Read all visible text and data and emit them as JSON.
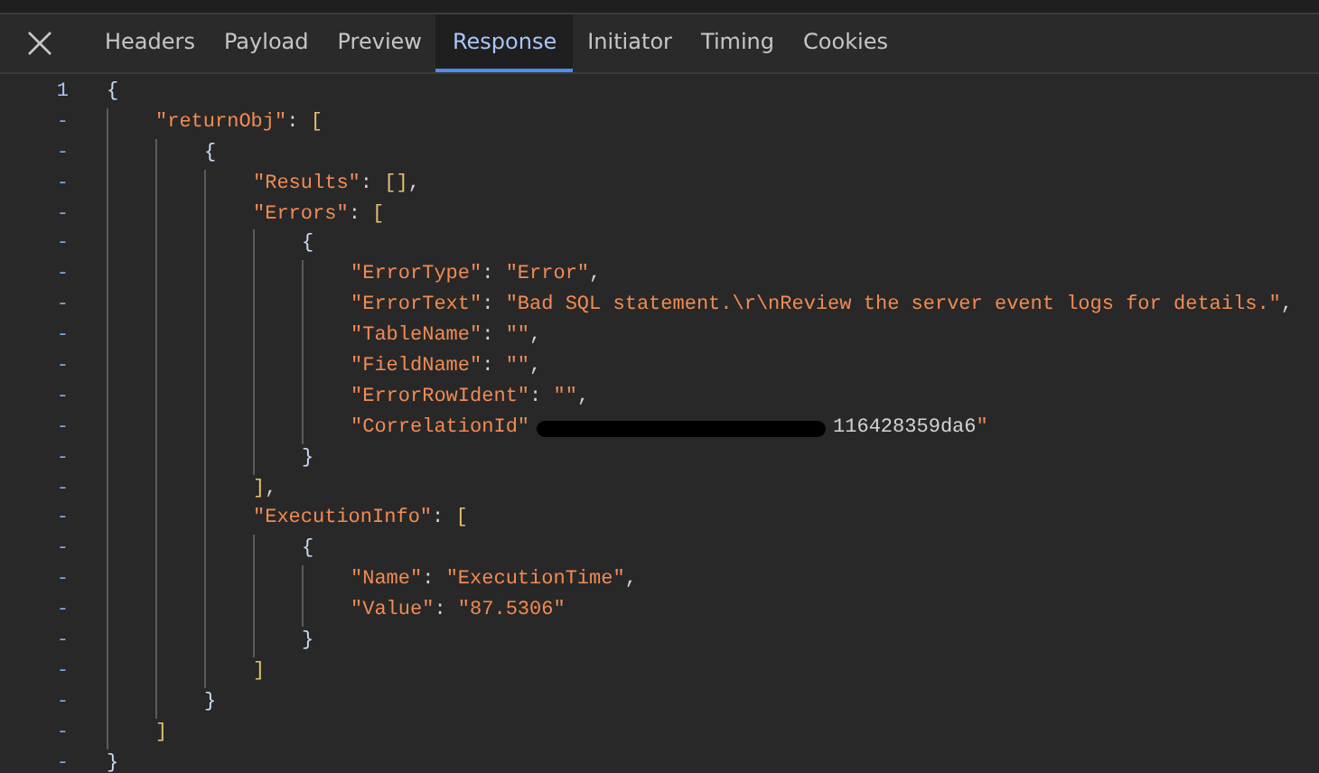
{
  "tabs": [
    {
      "label": "Headers",
      "selected": false
    },
    {
      "label": "Payload",
      "selected": false
    },
    {
      "label": "Preview",
      "selected": false
    },
    {
      "label": "Response",
      "selected": true
    },
    {
      "label": "Initiator",
      "selected": false
    },
    {
      "label": "Timing",
      "selected": false
    },
    {
      "label": "Cookies",
      "selected": false
    }
  ],
  "code": {
    "lines": [
      {
        "gutter": "1",
        "text": "{",
        "children": [
          {
            "gutter": "-",
            "text": "\"returnObj\": [",
            "children": [
              {
                "gutter": "-",
                "text": "{",
                "children": [
                  {
                    "gutter": "-",
                    "text": "\"Results\": [],"
                  },
                  {
                    "gutter": "-",
                    "text": "\"Errors\": [",
                    "children": [
                      {
                        "gutter": "-",
                        "text": "{",
                        "children": [
                          {
                            "gutter": "-",
                            "text": "\"ErrorType\": \"Error\","
                          },
                          {
                            "gutter": "-",
                            "text": "\"ErrorText\": \"Bad SQL statement.\\r\\nReview the server event logs for details.\","
                          },
                          {
                            "gutter": "-",
                            "text": "\"TableName\": \"\","
                          },
                          {
                            "gutter": "-",
                            "text": "\"FieldName\": \"\","
                          },
                          {
                            "gutter": "-",
                            "text": "\"ErrorRowIdent\": \"\","
                          },
                          {
                            "gutter": "-",
                            "text": "\"CorrelationId\"",
                            "redacted": true,
                            "tail": "116428359da6\""
                          }
                        ]
                      },
                      {
                        "gutter": "-",
                        "text": "}"
                      }
                    ]
                  },
                  {
                    "gutter": "-",
                    "text": "],"
                  },
                  {
                    "gutter": "-",
                    "text": "\"ExecutionInfo\": [",
                    "children": [
                      {
                        "gutter": "-",
                        "text": "{",
                        "children": [
                          {
                            "gutter": "-",
                            "text": "\"Name\": \"ExecutionTime\","
                          },
                          {
                            "gutter": "-",
                            "text": "\"Value\": \"87.5306\""
                          }
                        ]
                      },
                      {
                        "gutter": "-",
                        "text": "}"
                      }
                    ]
                  },
                  {
                    "gutter": "-",
                    "text": "]"
                  }
                ]
              },
              {
                "gutter": "-",
                "text": "}"
              }
            ]
          },
          {
            "gutter": "-",
            "text": "]"
          }
        ]
      },
      {
        "gutter": "-",
        "text": "}"
      }
    ]
  }
}
